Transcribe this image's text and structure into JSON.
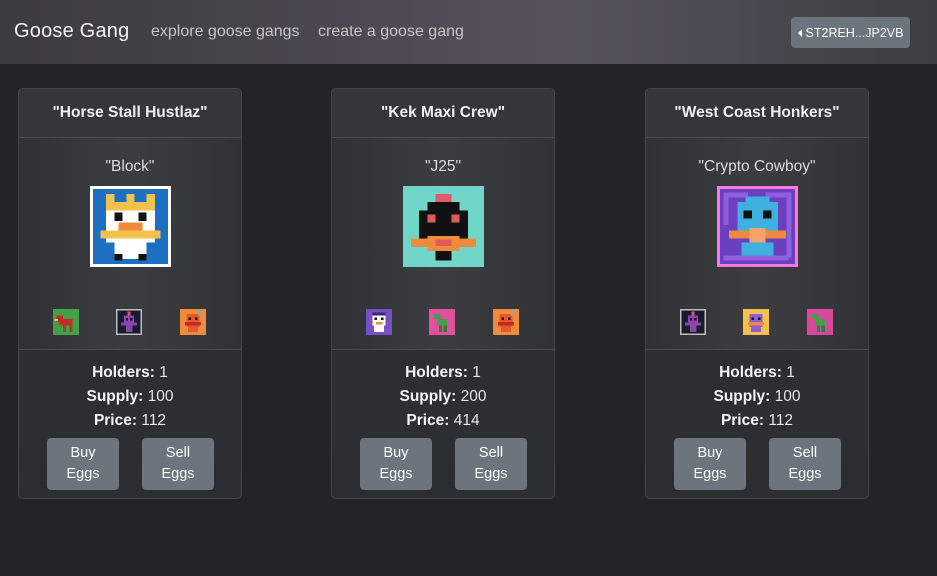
{
  "navbar": {
    "brand": "Goose Gang",
    "links": [
      "explore goose gangs",
      "create a goose gang"
    ],
    "wallet_label": "ST2REH...JP2VB",
    "wallet_icon": "caret-left-icon"
  },
  "labels": {
    "holders": "Holders:",
    "supply": "Supply:",
    "price": "Price:",
    "buy_line1": "Buy",
    "buy_line2": "Eggs",
    "sell_line1": "Sell",
    "sell_line2": "Eggs"
  },
  "gangs": [
    {
      "name": "\"Horse Stall Hustlaz\"",
      "leader": "\"Block\"",
      "holders": "1",
      "supply": "100",
      "price": "112",
      "leader_colors": {
        "bg": "#1d6fc2",
        "border": "#ffffff"
      },
      "member_colors": [
        "#43a047",
        "#1a1a2e",
        "#f08a3c"
      ]
    },
    {
      "name": "\"Kek Maxi Crew\"",
      "leader": "\"J25\"",
      "holders": "1",
      "supply": "200",
      "price": "414",
      "leader_colors": {
        "bg": "#6fd6c8",
        "border": "#6fd6c8"
      },
      "member_colors": [
        "#7b4fc4",
        "#e0509c",
        "#f08a3c"
      ]
    },
    {
      "name": "\"West Coast Honkers\"",
      "leader": "\"Crypto Cowboy\"",
      "holders": "1",
      "supply": "100",
      "price": "112",
      "leader_colors": {
        "bg": "#6a3fc0",
        "border": "#ff7ad9"
      },
      "member_colors": [
        "#1a1a2e",
        "#f2c14e",
        "#d64a9e"
      ]
    }
  ]
}
